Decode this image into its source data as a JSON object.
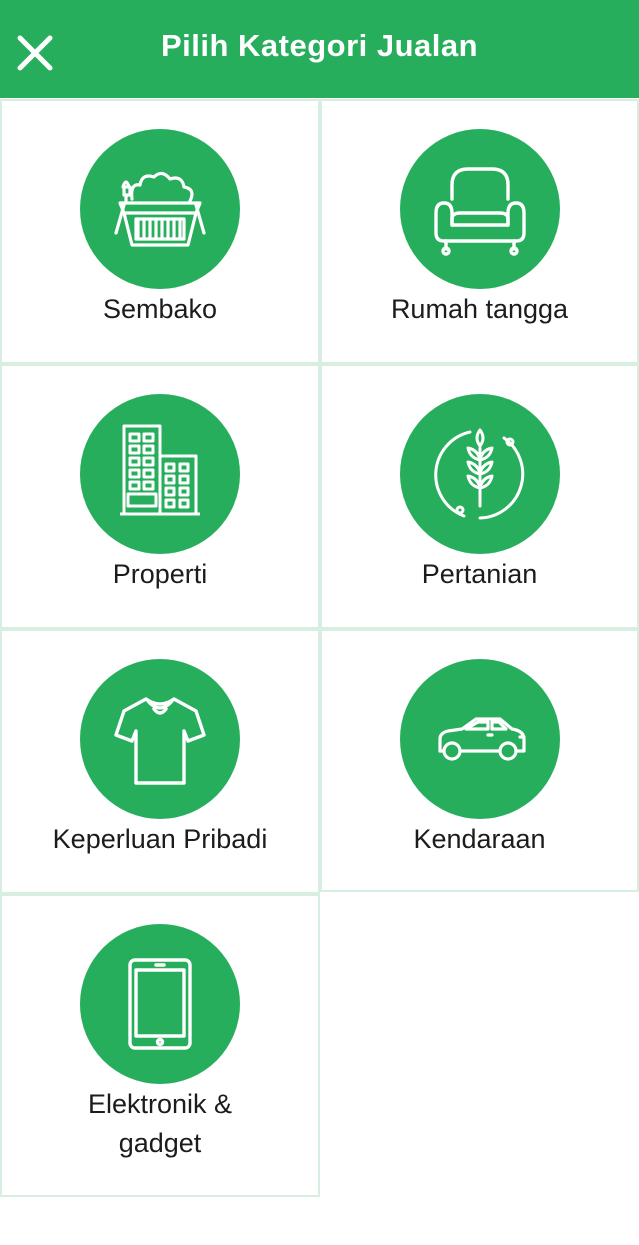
{
  "header": {
    "title": "Pilih Kategori Jualan",
    "close_icon": "close-icon",
    "background": "#27ae5c"
  },
  "categories": [
    {
      "label": "Sembako",
      "icon": "grocery-basket-icon"
    },
    {
      "label": "Rumah tangga",
      "icon": "armchair-icon"
    },
    {
      "label": "Properti",
      "icon": "buildings-icon"
    },
    {
      "label": "Pertanian",
      "icon": "wheat-icon"
    },
    {
      "label": "Keperluan Pribadi",
      "icon": "tshirt-icon"
    },
    {
      "label": "Kendaraan",
      "icon": "car-icon"
    },
    {
      "label": "Elektronik &",
      "label_line2": "gadget",
      "icon": "tablet-icon"
    }
  ],
  "colors": {
    "accent": "#27ae5c",
    "cell_border": "#d7efe0",
    "text": "#1c1c1c"
  }
}
